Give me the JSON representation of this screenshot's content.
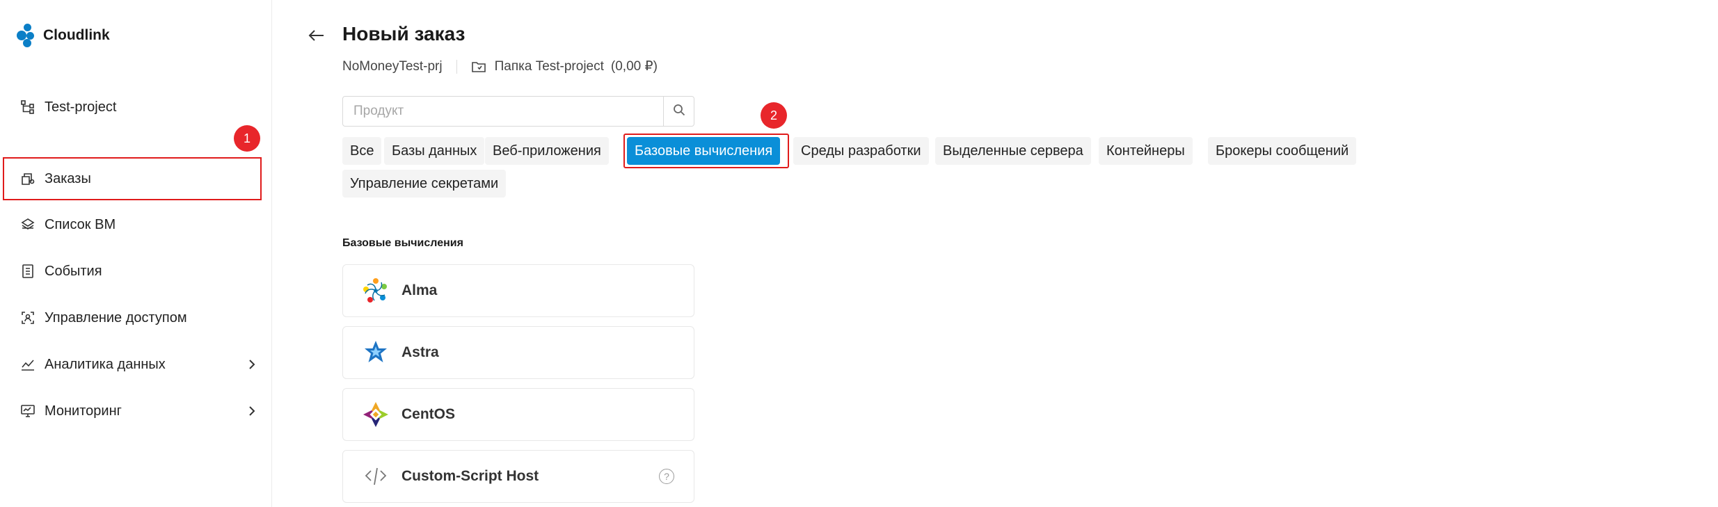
{
  "app": {
    "name": "Cloudlink",
    "brand_color": "#0b7fc7"
  },
  "sidebar": {
    "project": {
      "label": "Test-project",
      "icon": "project-tree-icon"
    },
    "items": [
      {
        "label": "Заказы",
        "icon": "orders-icon",
        "has_chevron": false,
        "highlighted": true
      },
      {
        "label": "Список ВМ",
        "icon": "vm-list-icon",
        "has_chevron": false
      },
      {
        "label": "События",
        "icon": "events-icon",
        "has_chevron": false
      },
      {
        "label": "Управление доступом",
        "icon": "access-icon",
        "has_chevron": false
      },
      {
        "label": "Аналитика данных",
        "icon": "analytics-icon",
        "has_chevron": true
      },
      {
        "label": "Мониторинг",
        "icon": "monitoring-icon",
        "has_chevron": true
      }
    ]
  },
  "annotations": {
    "badge_1": "1",
    "badge_2": "2",
    "highlight_color": "#e01b1b"
  },
  "header": {
    "title": "Новый заказ",
    "project_name": "NoMoneyTest-prj",
    "folder_label": "Папка Test-project",
    "folder_balance": "(0,00 ₽)"
  },
  "search": {
    "placeholder": "Продукт",
    "value": ""
  },
  "tabs": [
    {
      "label": "Все",
      "active": false
    },
    {
      "label": "Базы данных",
      "active": false
    },
    {
      "label": "Веб-приложения",
      "active": false
    },
    {
      "label": "Базовые вычисления",
      "active": true
    },
    {
      "label": "Среды разработки",
      "active": false
    },
    {
      "label": "Выделенные сервера",
      "active": false
    },
    {
      "label": "Контейнеры",
      "active": false
    },
    {
      "label": "Брокеры сообщений",
      "active": false
    },
    {
      "label": "Управление секретами",
      "active": false
    }
  ],
  "accent_color": "#0a8fd8",
  "section": {
    "title": "Базовые вычисления",
    "products": [
      {
        "name": "Alma",
        "icon": "alma-logo-icon"
      },
      {
        "name": "Astra",
        "icon": "astra-logo-icon"
      },
      {
        "name": "CentOS",
        "icon": "centos-logo-icon"
      },
      {
        "name": "Custom-Script Host",
        "icon": "code-icon",
        "help": "?"
      }
    ]
  }
}
